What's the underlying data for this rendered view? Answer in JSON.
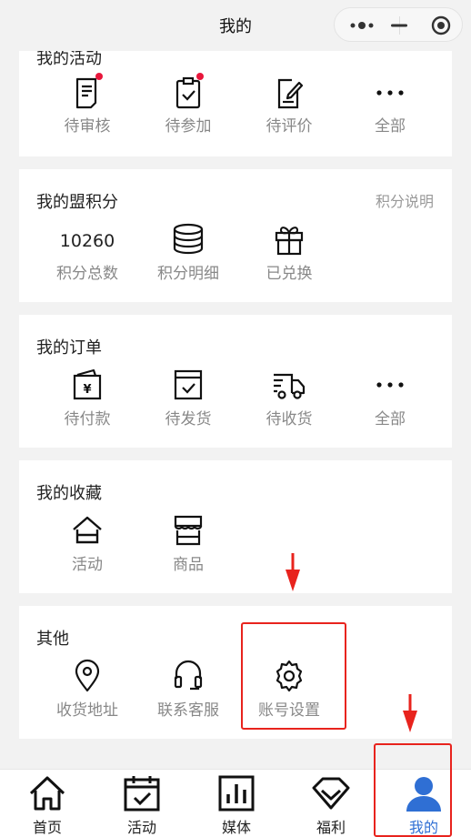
{
  "nav": {
    "title": "我的"
  },
  "activities": {
    "title": "我的活动",
    "items": [
      {
        "label": "待审核",
        "icon": "document-pending-icon",
        "dot": true
      },
      {
        "label": "待参加",
        "icon": "clipboard-check-icon",
        "dot": true
      },
      {
        "label": "待评价",
        "icon": "edit-document-icon",
        "dot": false
      },
      {
        "label": "全部",
        "icon": "more-dots-icon",
        "dot": false
      }
    ]
  },
  "points": {
    "title": "我的盟积分",
    "explain": "积分说明",
    "total_value": "10260",
    "items": [
      {
        "label": "积分总数"
      },
      {
        "label": "积分明细",
        "icon": "coin-stack-icon"
      },
      {
        "label": "已兑换",
        "icon": "gift-icon"
      }
    ]
  },
  "orders": {
    "title": "我的订单",
    "items": [
      {
        "label": "待付款",
        "icon": "wallet-yen-icon"
      },
      {
        "label": "待发货",
        "icon": "box-check-icon"
      },
      {
        "label": "待收货",
        "icon": "delivery-truck-icon"
      },
      {
        "label": "全部",
        "icon": "more-dots-icon"
      }
    ]
  },
  "favorites": {
    "title": "我的收藏",
    "items": [
      {
        "label": "活动",
        "icon": "home-outline-icon"
      },
      {
        "label": "商品",
        "icon": "storefront-icon"
      }
    ]
  },
  "others": {
    "title": "其他",
    "items": [
      {
        "label": "收货地址",
        "icon": "location-pin-icon"
      },
      {
        "label": "联系客服",
        "icon": "headset-icon"
      },
      {
        "label": "账号设置",
        "icon": "gear-icon"
      }
    ]
  },
  "tabbar": {
    "items": [
      {
        "label": "首页",
        "icon": "home-icon"
      },
      {
        "label": "活动",
        "icon": "calendar-check-icon"
      },
      {
        "label": "媒体",
        "icon": "bar-chart-icon"
      },
      {
        "label": "福利",
        "icon": "diamond-icon"
      },
      {
        "label": "我的",
        "icon": "user-icon",
        "active": true
      }
    ]
  },
  "colors": {
    "accent": "#2f6fd4",
    "badge": "#e8163b",
    "annotation": "#e8231d"
  }
}
